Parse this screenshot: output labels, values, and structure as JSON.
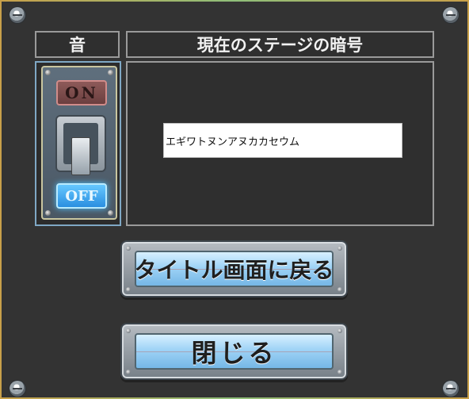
{
  "headers": {
    "sound": "音",
    "stage_code": "現在のステージの暗号"
  },
  "sound_switch": {
    "on_label": "ON",
    "off_label": "OFF",
    "state": "OFF"
  },
  "stage_code": {
    "value": "エギワトヌンアヌカカセウム"
  },
  "buttons": {
    "title_screen": "タイトル画面に戻る",
    "close": "閉じる"
  },
  "colors": {
    "panel_background": "#333333",
    "off_active": "#2a8fe0",
    "on_inactive": "#6b3f3f",
    "button_face": "#9fd3f6"
  },
  "icons": {
    "corner": "rivet-icon",
    "switch": "toggle-switch-icon"
  }
}
